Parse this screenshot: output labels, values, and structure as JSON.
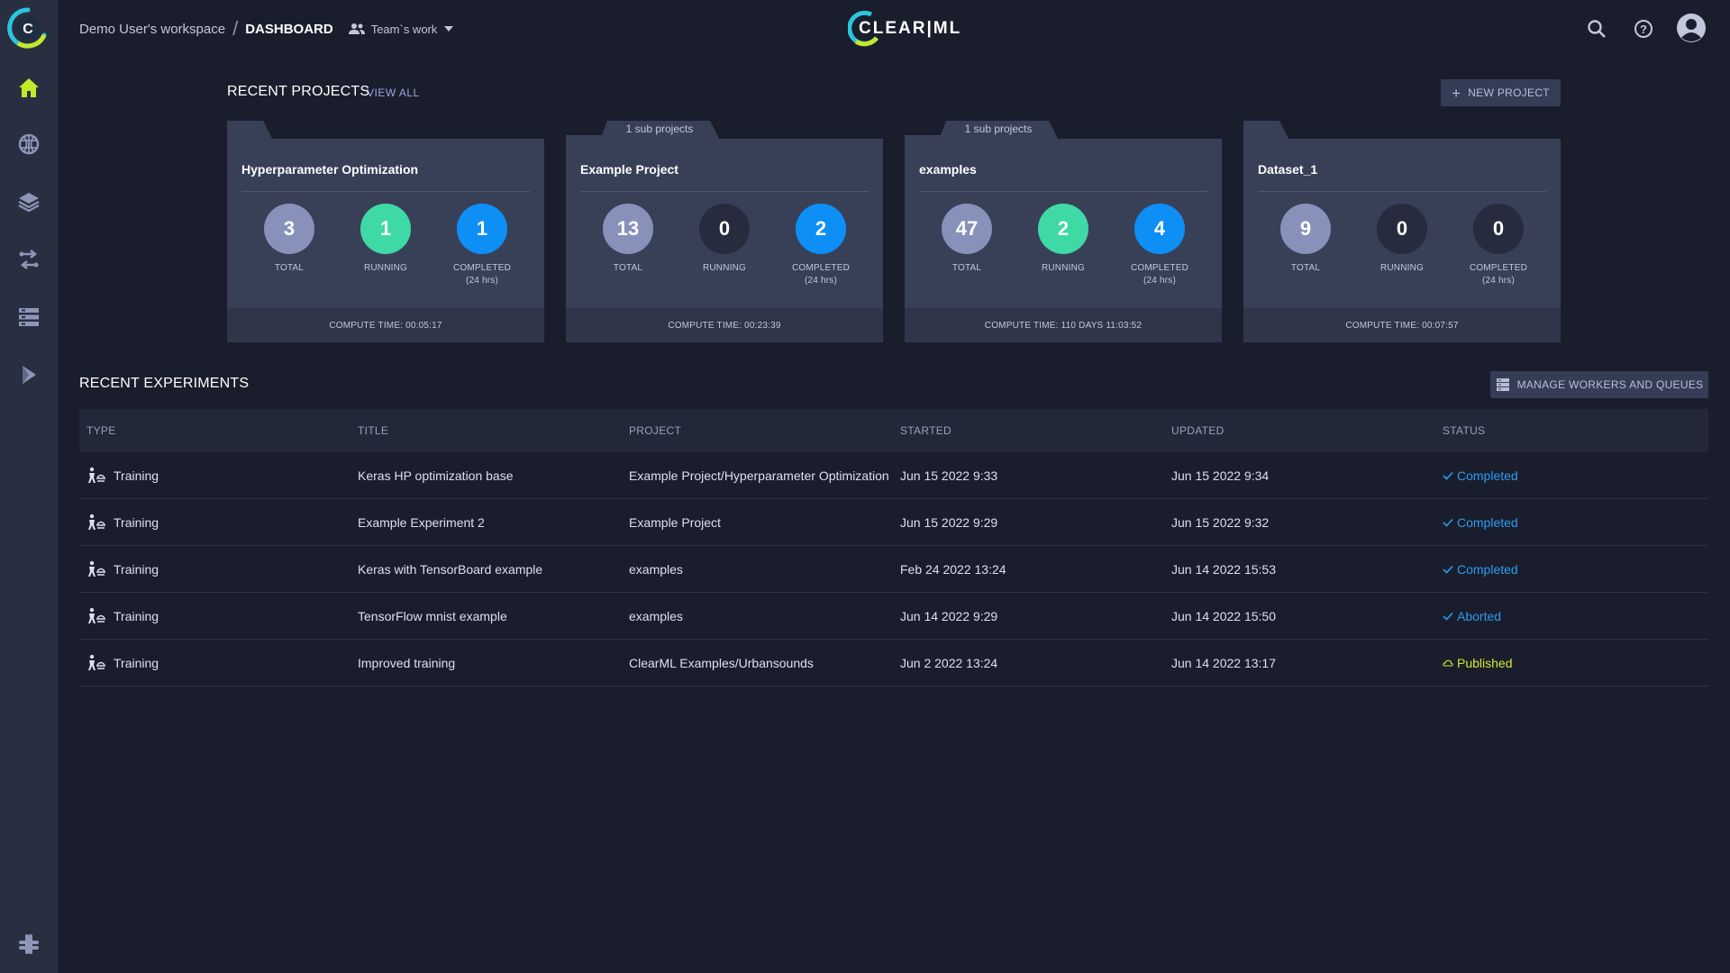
{
  "header": {
    "workspace": "Demo User's workspace",
    "separator": "/",
    "page": "DASHBOARD",
    "team_filter": "Team`s work",
    "brand": "CLEAR|ML"
  },
  "projects_section": {
    "title": "RECENT PROJECTS",
    "view_all": "VIEW ALL",
    "new_project": "NEW PROJECT"
  },
  "projects": [
    {
      "name": "Hyperparameter Optimization",
      "sub_projects": "",
      "total": "3",
      "running": "1",
      "completed": "1",
      "compute_time": "COMPUTE TIME: 00:05:17"
    },
    {
      "name": "Example Project",
      "sub_projects": "1 sub projects",
      "total": "13",
      "running": "0",
      "completed": "2",
      "compute_time": "COMPUTE TIME: 00:23:39"
    },
    {
      "name": "examples",
      "sub_projects": "1 sub projects",
      "total": "47",
      "running": "2",
      "completed": "4",
      "compute_time": "COMPUTE TIME: 110 DAYS 11:03:52"
    },
    {
      "name": "Dataset_1",
      "sub_projects": "",
      "total": "9",
      "running": "0",
      "completed": "0",
      "compute_time": "COMPUTE TIME: 00:07:57"
    }
  ],
  "stat_labels": {
    "total": "TOTAL",
    "running": "RUNNING",
    "completed": "COMPLETED",
    "completed_sub": "(24 hrs)"
  },
  "experiments_section": {
    "title": "RECENT EXPERIMENTS",
    "manage_workers": "MANAGE WORKERS AND QUEUES"
  },
  "experiments_table": {
    "columns": [
      "TYPE",
      "TITLE",
      "PROJECT",
      "STARTED",
      "UPDATED",
      "STATUS"
    ],
    "rows": [
      {
        "type": "Training",
        "title": "Keras HP optimization base",
        "project": "Example Project/Hyperparameter Optimization",
        "started": "Jun 15 2022 9:33",
        "updated": "Jun 15 2022 9:34",
        "status": "Completed"
      },
      {
        "type": "Training",
        "title": "Example Experiment 2",
        "project": "Example Project",
        "started": "Jun 15 2022 9:29",
        "updated": "Jun 15 2022 9:32",
        "status": "Completed"
      },
      {
        "type": "Training",
        "title": "Keras with TensorBoard example",
        "project": "examples",
        "started": "Feb 24 2022 13:24",
        "updated": "Jun 14 2022 15:53",
        "status": "Completed"
      },
      {
        "type": "Training",
        "title": "TensorFlow mnist example",
        "project": "examples",
        "started": "Jun 14 2022 9:29",
        "updated": "Jun 14 2022 15:50",
        "status": "Aborted"
      },
      {
        "type": "Training",
        "title": "Improved training",
        "project": "ClearML Examples/Urbansounds",
        "started": "Jun 2 2022 13:24",
        "updated": "Jun 14 2022 13:17",
        "status": "Published"
      }
    ]
  },
  "sidebar": {
    "items": [
      {
        "icon": "home-icon"
      },
      {
        "icon": "brain-icon"
      },
      {
        "icon": "layers-icon"
      },
      {
        "icon": "pipelines-icon"
      },
      {
        "icon": "workers-icon"
      },
      {
        "icon": "deploy-icon"
      },
      {
        "icon": "slack-icon"
      }
    ]
  },
  "colors": {
    "background": "#1a1e2c",
    "sidebar": "#282f41",
    "card": "#384058",
    "total": "#8791ba",
    "running": "#3fd9a6",
    "completed": "#0d8ff6",
    "status_completed": "#2b9bf4",
    "status_published": "#d6e82c",
    "accent": "#c4e82a"
  }
}
